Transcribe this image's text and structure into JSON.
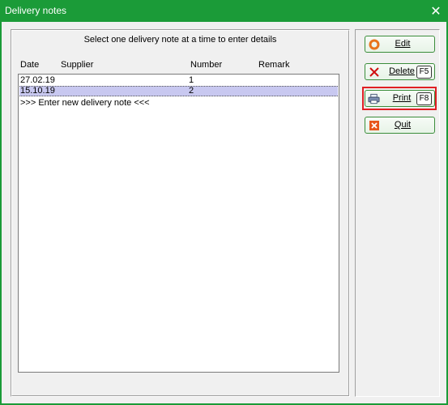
{
  "window": {
    "title": "Delivery notes",
    "close_glyph": "✕"
  },
  "instruction": "Select one delivery note at a time to enter details",
  "columns": {
    "date": "Date",
    "supplier": "Supplier",
    "number": "Number",
    "remark": "Remark"
  },
  "rows": [
    {
      "date": "27.02.19",
      "supplier": "",
      "number": "1",
      "remark": ""
    },
    {
      "date": "15.10.19",
      "supplier": "",
      "number": "2",
      "remark": ""
    }
  ],
  "new_entry": ">>> Enter new delivery note <<<",
  "buttons": {
    "edit": {
      "label": "Edit",
      "icon": "edit-ring-icon"
    },
    "delete": {
      "label": "Delete",
      "key": "F5",
      "icon": "red-x-icon"
    },
    "print": {
      "label": "Print",
      "key": "F8",
      "icon": "printer-icon"
    },
    "quit": {
      "label": "Quit",
      "icon": "quit-icon"
    }
  },
  "colors": {
    "accent": "#1b9b38",
    "highlight": "#e01e24",
    "selection": "#c8c8f0"
  }
}
